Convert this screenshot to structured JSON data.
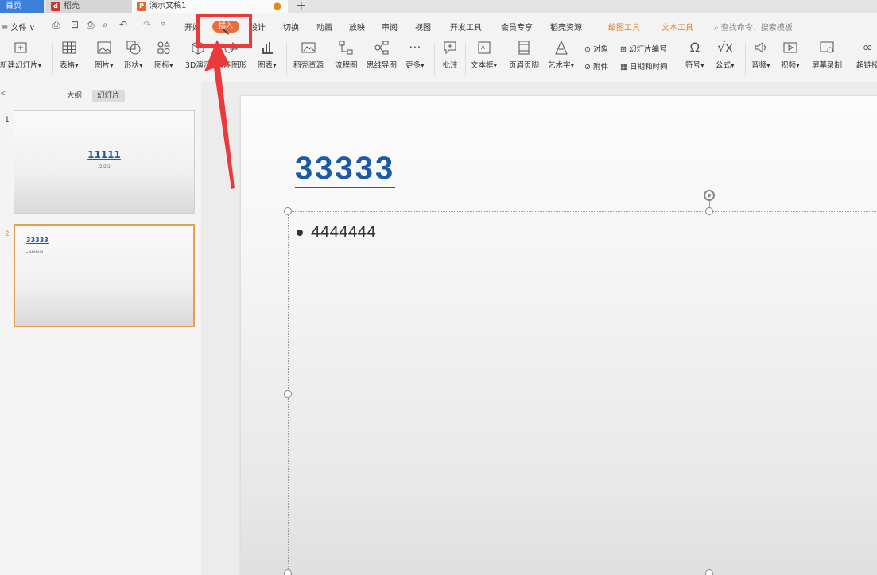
{
  "tabs": {
    "home": "首页",
    "shell": "稻壳",
    "document": "演示文稿1",
    "add": "+"
  },
  "menu": {
    "file": "≡ 文件 ∨",
    "items": [
      "开始",
      "插入",
      "设计",
      "切换",
      "动画",
      "放映",
      "审阅",
      "视图",
      "开发工具",
      "会员专享",
      "稻壳资源"
    ],
    "context_tools": [
      "绘图工具",
      "文本工具"
    ],
    "search_placeholder": "查找命令、搜索模板"
  },
  "ribbon": {
    "new_slide": "新建幻灯片",
    "table": "表格",
    "picture": "图片",
    "shape": "形状",
    "icon": "图标",
    "model3d": "3D演示",
    "smart_graphic": "智能图形",
    "chart": "图表",
    "shell_resource": "稻壳资源",
    "flowchart": "流程图",
    "mindmap": "思维导图",
    "more": "更多",
    "comment": "批注",
    "textbox": "文本框",
    "header_footer": "页眉页脚",
    "wordart": "艺术字",
    "object": "对象",
    "attachment": "附件",
    "slide_number": "幻灯片编号",
    "date_time": "日期和时间",
    "symbol": "符号",
    "formula": "公式",
    "audio": "音频",
    "video": "视频",
    "screen_record": "屏幕录制",
    "hyperlink": "超链接"
  },
  "panel": {
    "outline_tab": "大纲",
    "slides_tab": "幻灯片",
    "close": "<"
  },
  "slides": [
    {
      "number": "1",
      "title": "11111",
      "subtitle": "222222"
    },
    {
      "number": "2",
      "title": "33333",
      "body": "• 4444444"
    }
  ],
  "current_slide": {
    "title": "33333",
    "bullet": "4444444"
  },
  "colors": {
    "accent": "#e46f3f",
    "title_blue": "#1d5aa6",
    "annotation": "#ea3a3a",
    "selected_thumb": "#e3a14f"
  }
}
